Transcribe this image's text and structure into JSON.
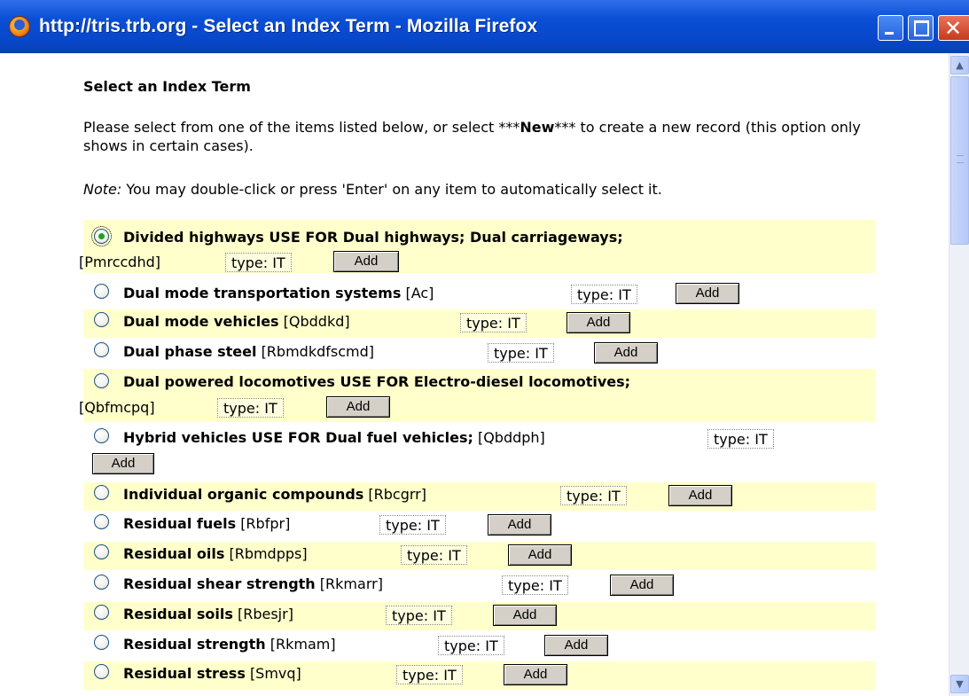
{
  "window": {
    "title": "http://tris.trb.org - Select an Index Term - Mozilla Firefox"
  },
  "page": {
    "heading": "Select an Index Term",
    "instructions_pre": "Please select from one of the items listed below, or select ***",
    "instructions_bold": "New",
    "instructions_post": "*** to create a new record (this option only shows in certain cases).",
    "note_label": "Note:",
    "note_text": " You may double-click or press 'Enter' on any item to automatically select it."
  },
  "items": [
    {
      "term": "Divided highways USE FOR Dual highways; Dual carriageways;",
      "code": "[Pmrccdhd]",
      "type": "type: IT",
      "add": "Add",
      "selected": true,
      "highlighted": true
    },
    {
      "term": "Dual mode transportation systems",
      "code": "[Ac]",
      "type": "type: IT",
      "add": "Add",
      "selected": false,
      "highlighted": false
    },
    {
      "term": "Dual mode vehicles",
      "code": "[Qbddkd]",
      "type": "type: IT",
      "add": "Add",
      "selected": false,
      "highlighted": true
    },
    {
      "term": "Dual phase steel",
      "code": "[Rbmdkdfscmd]",
      "type": "type: IT",
      "add": "Add",
      "selected": false,
      "highlighted": false
    },
    {
      "term": "Dual powered locomotives USE FOR Electro-diesel locomotives;",
      "code": "[Qbfmcpq]",
      "type": "type: IT",
      "add": "Add",
      "selected": false,
      "highlighted": true
    },
    {
      "term": "Hybrid vehicles USE FOR Dual fuel vehicles;",
      "code": "[Qbddph]",
      "type": "type: IT",
      "add": "Add",
      "selected": false,
      "highlighted": false
    },
    {
      "term": "Individual organic compounds",
      "code": "[Rbcgrr]",
      "type": "type: IT",
      "add": "Add",
      "selected": false,
      "highlighted": true
    },
    {
      "term": "Residual fuels",
      "code": "[Rbfpr]",
      "type": "type: IT",
      "add": "Add",
      "selected": false,
      "highlighted": false
    },
    {
      "term": "Residual oils",
      "code": "[Rbmdpps]",
      "type": "type: IT",
      "add": "Add",
      "selected": false,
      "highlighted": true
    },
    {
      "term": "Residual shear strength",
      "code": "[Rkmarr]",
      "type": "type: IT",
      "add": "Add",
      "selected": false,
      "highlighted": false
    },
    {
      "term": "Residual soils",
      "code": "[Rbesjr]",
      "type": "type: IT",
      "add": "Add",
      "selected": false,
      "highlighted": true
    },
    {
      "term": "Residual strength",
      "code": "[Rkmam]",
      "type": "type: IT",
      "add": "Add",
      "selected": false,
      "highlighted": false
    },
    {
      "term": "Residual stress",
      "code": "[Smvq]",
      "type": "type: IT",
      "add": "Add",
      "selected": false,
      "highlighted": true
    }
  ]
}
